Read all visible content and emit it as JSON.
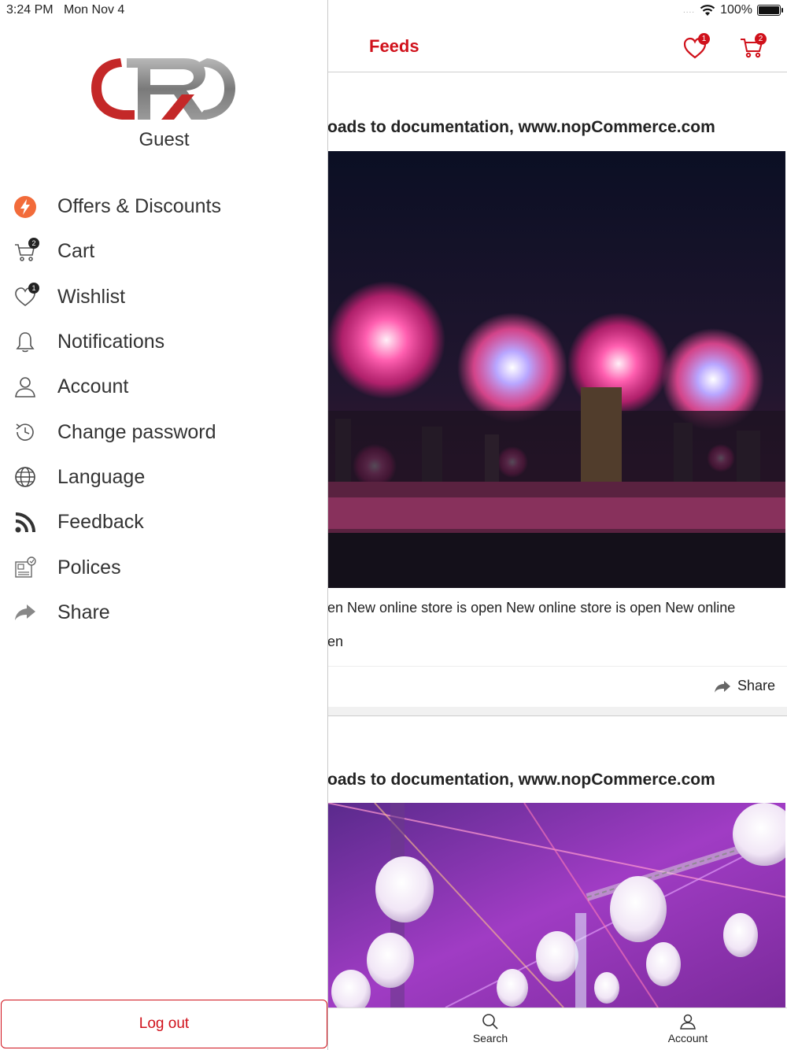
{
  "status_bar": {
    "time": "3:24 PM",
    "date": "Mon Nov 4",
    "signal": "....",
    "battery": "100%",
    "battery_level": 1.0
  },
  "drawer": {
    "user": "Guest",
    "menu": [
      {
        "label": "Offers & Discounts",
        "icon": "offers-icon"
      },
      {
        "label": "Cart",
        "icon": "cart-icon",
        "badge": "2"
      },
      {
        "label": "Wishlist",
        "icon": "heart-icon",
        "badge": "1"
      },
      {
        "label": "Notifications",
        "icon": "bell-icon"
      },
      {
        "label": "Account",
        "icon": "user-icon"
      },
      {
        "label": "Change password",
        "icon": "history-icon"
      },
      {
        "label": "Language",
        "icon": "globe-icon"
      },
      {
        "label": "Feedback",
        "icon": "rss-icon"
      },
      {
        "label": "Polices",
        "icon": "policy-icon"
      },
      {
        "label": "Share",
        "icon": "share-icon"
      }
    ],
    "logout_label": "Log out"
  },
  "header": {
    "title": "Feeds",
    "wishlist_badge": "1",
    "cart_badge": "2"
  },
  "feeds": [
    {
      "title": "oads to documentation, www.nopCommerce.com",
      "image": "fireworks-city-night",
      "description": "en New online store is open New online store is open New online",
      "description_cont": "en",
      "share_label": "Share"
    },
    {
      "title": "oads to documentation, www.nopCommerce.com",
      "image": "purple-lanterns-event"
    }
  ],
  "bottom_nav": {
    "search_label": "Search",
    "account_label": "Account"
  },
  "colors": {
    "accent": "#d0111b",
    "text": "#222222"
  }
}
